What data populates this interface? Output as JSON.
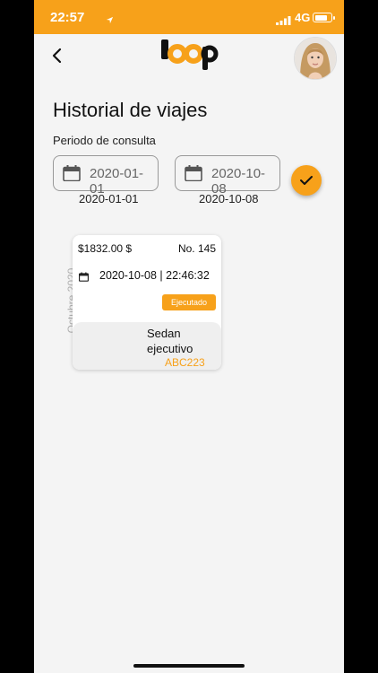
{
  "status_bar": {
    "time": "22:57",
    "network": "4G"
  },
  "header": {
    "logo_text": "loop"
  },
  "page": {
    "title": "Historial de viajes",
    "period_label": "Periodo de consulta"
  },
  "filters": {
    "start_date": "2020-01-01",
    "end_date": "2020-10-08",
    "start_date_caption": "2020-01-01",
    "end_date_caption": "2020-10-08"
  },
  "month_label": "Octubre 2020",
  "trips": [
    {
      "amount": "$1832.00 $",
      "number": "No. 145",
      "datetime": "2020-10-08 | 22:46:32",
      "status": "Ejecutado",
      "vehicle_type": "Sedan ejecutivo",
      "plate": "ABC223"
    }
  ],
  "colors": {
    "accent": "#f7a11a",
    "background": "#f4f4f4"
  }
}
